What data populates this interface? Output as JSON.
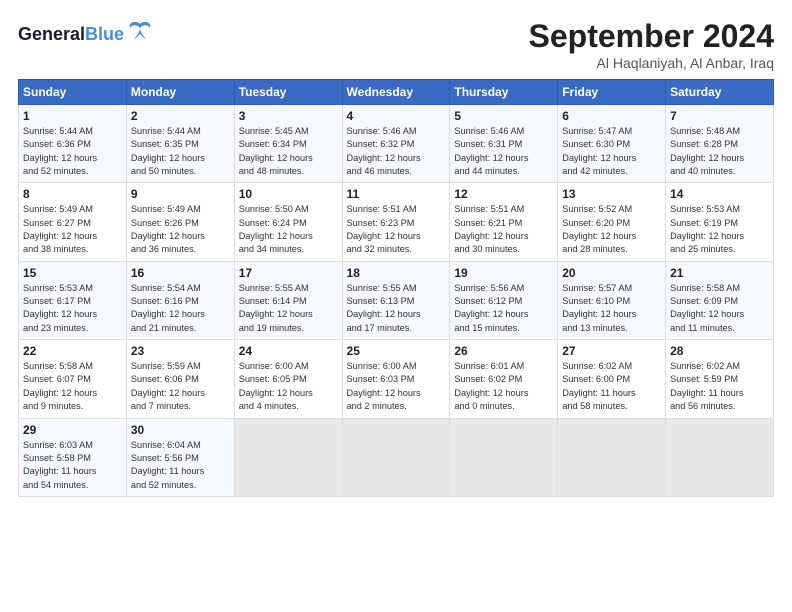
{
  "header": {
    "logo_line1": "General",
    "logo_line2": "Blue",
    "month": "September 2024",
    "location": "Al Haqlaniyah, Al Anbar, Iraq"
  },
  "weekdays": [
    "Sunday",
    "Monday",
    "Tuesday",
    "Wednesday",
    "Thursday",
    "Friday",
    "Saturday"
  ],
  "weeks": [
    [
      {
        "day": "1",
        "info": "Sunrise: 5:44 AM\nSunset: 6:36 PM\nDaylight: 12 hours\nand 52 minutes."
      },
      {
        "day": "2",
        "info": "Sunrise: 5:44 AM\nSunset: 6:35 PM\nDaylight: 12 hours\nand 50 minutes."
      },
      {
        "day": "3",
        "info": "Sunrise: 5:45 AM\nSunset: 6:34 PM\nDaylight: 12 hours\nand 48 minutes."
      },
      {
        "day": "4",
        "info": "Sunrise: 5:46 AM\nSunset: 6:32 PM\nDaylight: 12 hours\nand 46 minutes."
      },
      {
        "day": "5",
        "info": "Sunrise: 5:46 AM\nSunset: 6:31 PM\nDaylight: 12 hours\nand 44 minutes."
      },
      {
        "day": "6",
        "info": "Sunrise: 5:47 AM\nSunset: 6:30 PM\nDaylight: 12 hours\nand 42 minutes."
      },
      {
        "day": "7",
        "info": "Sunrise: 5:48 AM\nSunset: 6:28 PM\nDaylight: 12 hours\nand 40 minutes."
      }
    ],
    [
      {
        "day": "8",
        "info": "Sunrise: 5:49 AM\nSunset: 6:27 PM\nDaylight: 12 hours\nand 38 minutes."
      },
      {
        "day": "9",
        "info": "Sunrise: 5:49 AM\nSunset: 6:26 PM\nDaylight: 12 hours\nand 36 minutes."
      },
      {
        "day": "10",
        "info": "Sunrise: 5:50 AM\nSunset: 6:24 PM\nDaylight: 12 hours\nand 34 minutes."
      },
      {
        "day": "11",
        "info": "Sunrise: 5:51 AM\nSunset: 6:23 PM\nDaylight: 12 hours\nand 32 minutes."
      },
      {
        "day": "12",
        "info": "Sunrise: 5:51 AM\nSunset: 6:21 PM\nDaylight: 12 hours\nand 30 minutes."
      },
      {
        "day": "13",
        "info": "Sunrise: 5:52 AM\nSunset: 6:20 PM\nDaylight: 12 hours\nand 28 minutes."
      },
      {
        "day": "14",
        "info": "Sunrise: 5:53 AM\nSunset: 6:19 PM\nDaylight: 12 hours\nand 25 minutes."
      }
    ],
    [
      {
        "day": "15",
        "info": "Sunrise: 5:53 AM\nSunset: 6:17 PM\nDaylight: 12 hours\nand 23 minutes."
      },
      {
        "day": "16",
        "info": "Sunrise: 5:54 AM\nSunset: 6:16 PM\nDaylight: 12 hours\nand 21 minutes."
      },
      {
        "day": "17",
        "info": "Sunrise: 5:55 AM\nSunset: 6:14 PM\nDaylight: 12 hours\nand 19 minutes."
      },
      {
        "day": "18",
        "info": "Sunrise: 5:55 AM\nSunset: 6:13 PM\nDaylight: 12 hours\nand 17 minutes."
      },
      {
        "day": "19",
        "info": "Sunrise: 5:56 AM\nSunset: 6:12 PM\nDaylight: 12 hours\nand 15 minutes."
      },
      {
        "day": "20",
        "info": "Sunrise: 5:57 AM\nSunset: 6:10 PM\nDaylight: 12 hours\nand 13 minutes."
      },
      {
        "day": "21",
        "info": "Sunrise: 5:58 AM\nSunset: 6:09 PM\nDaylight: 12 hours\nand 11 minutes."
      }
    ],
    [
      {
        "day": "22",
        "info": "Sunrise: 5:58 AM\nSunset: 6:07 PM\nDaylight: 12 hours\nand 9 minutes."
      },
      {
        "day": "23",
        "info": "Sunrise: 5:59 AM\nSunset: 6:06 PM\nDaylight: 12 hours\nand 7 minutes."
      },
      {
        "day": "24",
        "info": "Sunrise: 6:00 AM\nSunset: 6:05 PM\nDaylight: 12 hours\nand 4 minutes."
      },
      {
        "day": "25",
        "info": "Sunrise: 6:00 AM\nSunset: 6:03 PM\nDaylight: 12 hours\nand 2 minutes."
      },
      {
        "day": "26",
        "info": "Sunrise: 6:01 AM\nSunset: 6:02 PM\nDaylight: 12 hours\nand 0 minutes."
      },
      {
        "day": "27",
        "info": "Sunrise: 6:02 AM\nSunset: 6:00 PM\nDaylight: 11 hours\nand 58 minutes."
      },
      {
        "day": "28",
        "info": "Sunrise: 6:02 AM\nSunset: 5:59 PM\nDaylight: 11 hours\nand 56 minutes."
      }
    ],
    [
      {
        "day": "29",
        "info": "Sunrise: 6:03 AM\nSunset: 5:58 PM\nDaylight: 11 hours\nand 54 minutes."
      },
      {
        "day": "30",
        "info": "Sunrise: 6:04 AM\nSunset: 5:56 PM\nDaylight: 11 hours\nand 52 minutes."
      },
      null,
      null,
      null,
      null,
      null
    ]
  ]
}
